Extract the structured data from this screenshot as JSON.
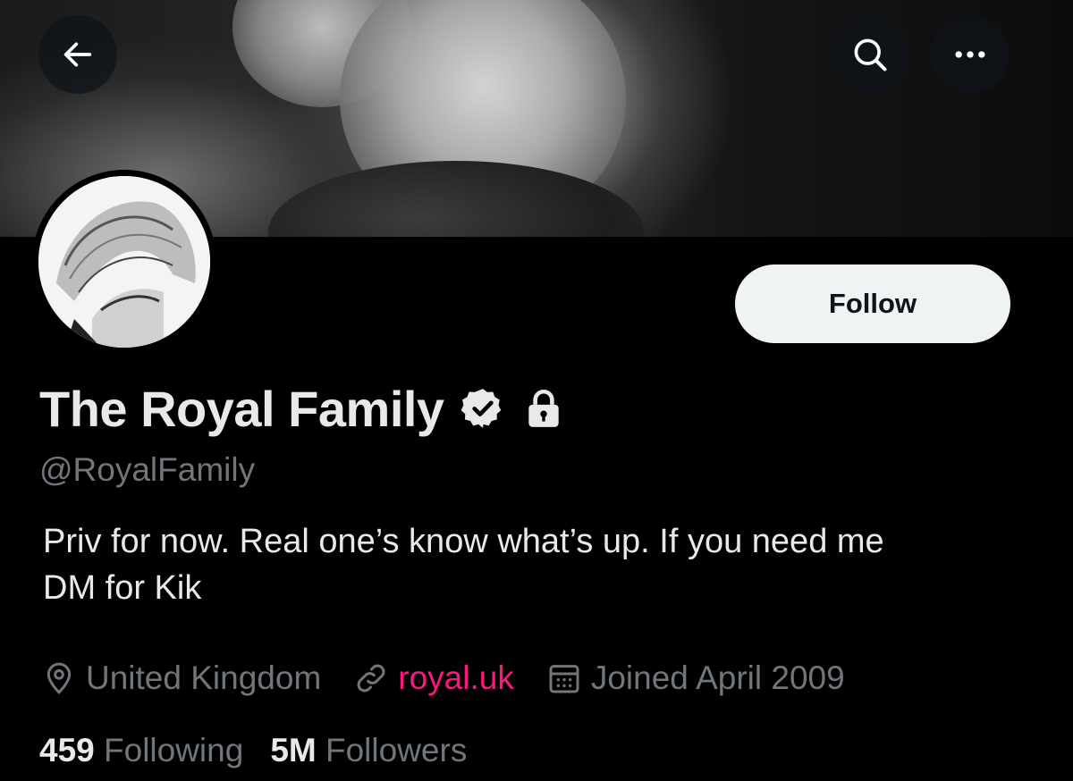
{
  "header": {
    "back_icon": "arrow-left-icon",
    "search_icon": "search-icon",
    "more_icon": "more-horizontal-icon"
  },
  "profile": {
    "display_name": "The Royal Family",
    "handle": "@RoyalFamily",
    "verified_icon": "verified-badge-icon",
    "protected_icon": "lock-icon",
    "follow_label": "Follow",
    "bio_line1": "Priv for now.  Real one’s know what’s up.  If you need me",
    "bio_line2": "DM for Kik",
    "location": "United Kingdom",
    "website": "royal.uk",
    "joined": "Joined April 2009",
    "following_count": "459",
    "following_label": "Following",
    "followers_count": "5M",
    "followers_label": "Followers"
  },
  "colors": {
    "background": "#000000",
    "text_primary": "#e7e9ea",
    "text_secondary": "#71767b",
    "link": "#f91880",
    "follow_button_bg": "#eff3f4"
  }
}
